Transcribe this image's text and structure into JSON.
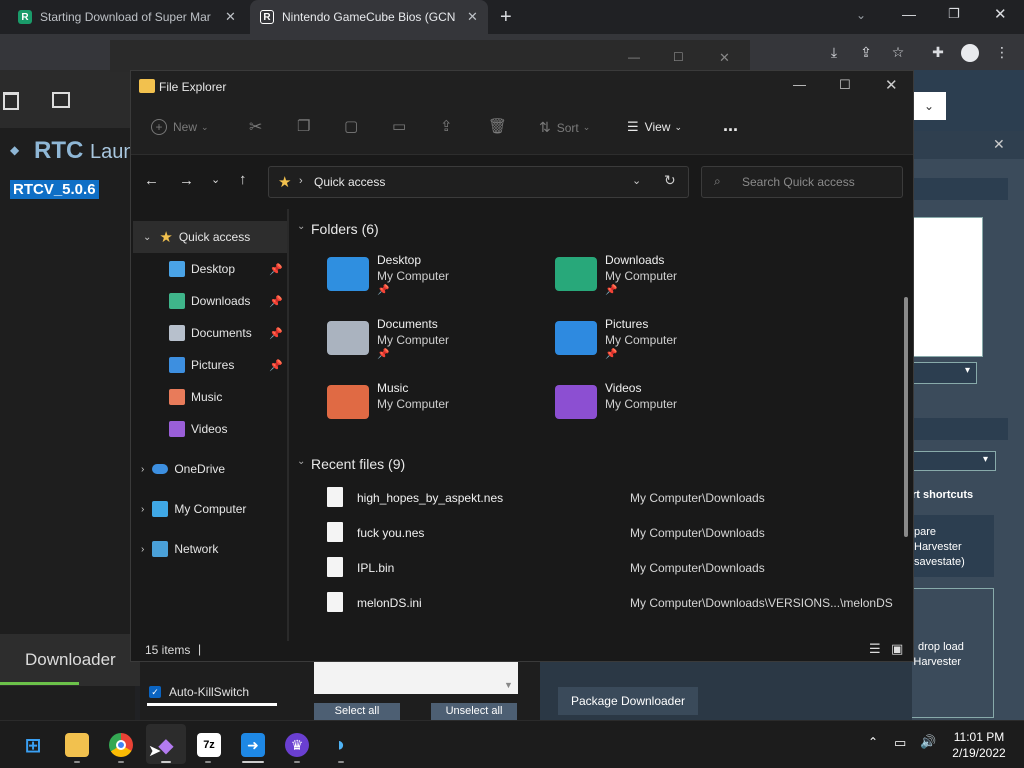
{
  "browser": {
    "tabs": [
      {
        "label": "Starting Download of Super Mar",
        "favicon": "R"
      },
      {
        "label": "Nintendo GameCube Bios (GCN",
        "favicon": "R"
      }
    ],
    "new_tab": "+"
  },
  "rtc": {
    "title": "RTC",
    "title_suffix": "Laune",
    "version": "RTCV_5.0.6",
    "downloader": "Downloader",
    "autokill": "Auto-KillSwitch",
    "select_all": "Select all",
    "unselect_all": "Unselect all",
    "package_downloader": "Package Downloader"
  },
  "right_panel": {
    "shortcuts": "rt shortcuts",
    "box1_l1": "pare",
    "box1_l2": "Harvester",
    "box1_l3": "savestate)",
    "box2_l1": "drop load",
    "box2_l2": "to Glitch Harvester"
  },
  "explorer": {
    "title": "File Explorer",
    "cmd": {
      "new": "New",
      "sort": "Sort",
      "view": "View",
      "more": "..."
    },
    "address": "Quick access",
    "search_placeholder": "Search Quick access",
    "nav": {
      "quick_access": "Quick access",
      "items": [
        {
          "label": "Desktop",
          "pinned": true,
          "color": "#4aa3e6"
        },
        {
          "label": "Downloads",
          "pinned": true,
          "color": "#3fb58a"
        },
        {
          "label": "Documents",
          "pinned": true,
          "color": "#b7c0cc"
        },
        {
          "label": "Pictures",
          "pinned": true,
          "color": "#3d8fe0"
        },
        {
          "label": "Music",
          "pinned": false,
          "color": "#e87b5a"
        },
        {
          "label": "Videos",
          "pinned": false,
          "color": "#9a5fd8"
        }
      ],
      "onedrive": "OneDrive",
      "my_computer": "My Computer",
      "network": "Network"
    },
    "folders_header": "Folders (6)",
    "folders": [
      {
        "name": "Desktop",
        "location": "My Computer",
        "pinned": true,
        "color": "#2f8fe0"
      },
      {
        "name": "Downloads",
        "location": "My Computer",
        "pinned": true,
        "color": "#28a87a"
      },
      {
        "name": "Documents",
        "location": "My Computer",
        "pinned": true,
        "color": "#aab3bf"
      },
      {
        "name": "Pictures",
        "location": "My Computer",
        "pinned": true,
        "color": "#2e8ae0"
      },
      {
        "name": "Music",
        "location": "My Computer",
        "pinned": false,
        "color": "#e06a44"
      },
      {
        "name": "Videos",
        "location": "My Computer",
        "pinned": false,
        "color": "#8c4fd2"
      }
    ],
    "recent_header": "Recent files (9)",
    "recent": [
      {
        "name": "high_hopes_by_aspekt.nes",
        "path": "My Computer\\Downloads"
      },
      {
        "name": "fuck you.nes",
        "path": "My Computer\\Downloads"
      },
      {
        "name": "IPL.bin",
        "path": "My Computer\\Downloads"
      },
      {
        "name": "melonDS.ini",
        "path": "My Computer\\Downloads\\VERSIONS...\\melonDS"
      }
    ],
    "status": "15 items"
  },
  "taskbar": {
    "time": "11:01 PM",
    "date": "2/19/2022",
    "apps": [
      {
        "name": "start",
        "label": ""
      },
      {
        "name": "file-explorer",
        "label": ""
      },
      {
        "name": "chrome",
        "label": ""
      },
      {
        "name": "rtc",
        "label": ""
      },
      {
        "name": "7zip",
        "label": "7z"
      },
      {
        "name": "app-arrow",
        "label": ""
      },
      {
        "name": "app-monster",
        "label": ""
      },
      {
        "name": "dolphin",
        "label": ""
      }
    ]
  }
}
